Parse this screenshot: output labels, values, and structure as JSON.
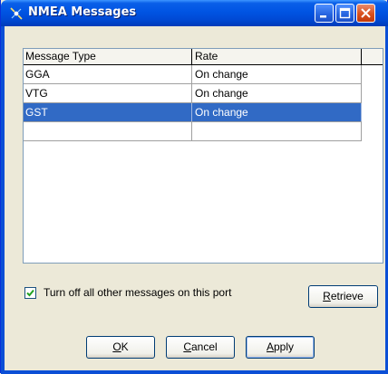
{
  "window": {
    "title": "NMEA Messages",
    "titlebar_color": "#0054e3",
    "close_color": "#d9501c"
  },
  "list": {
    "columns": [
      "Message Type",
      "Rate"
    ],
    "rows": [
      {
        "type": "GGA",
        "rate": "On change"
      },
      {
        "type": "VTG",
        "rate": "On change"
      },
      {
        "type": "GST",
        "rate": "On change"
      },
      {
        "type": "",
        "rate": ""
      }
    ],
    "selected_index": 2,
    "selection_color": "#316ac5"
  },
  "options": {
    "turn_off_label": "Turn off all other messages on this port",
    "turn_off_checked": true
  },
  "buttons": {
    "retrieve_first": "R",
    "retrieve_rest": "etrieve",
    "ok_first": "O",
    "ok_rest": "K",
    "cancel_first": "C",
    "cancel_rest": "ancel",
    "apply_first": "A",
    "apply_rest": "pply"
  },
  "icons": {
    "app": "gps-satellite-icon",
    "minimize": "minimize-icon",
    "maximize": "maximize-icon",
    "close": "close-icon",
    "check": "checkmark-icon"
  }
}
